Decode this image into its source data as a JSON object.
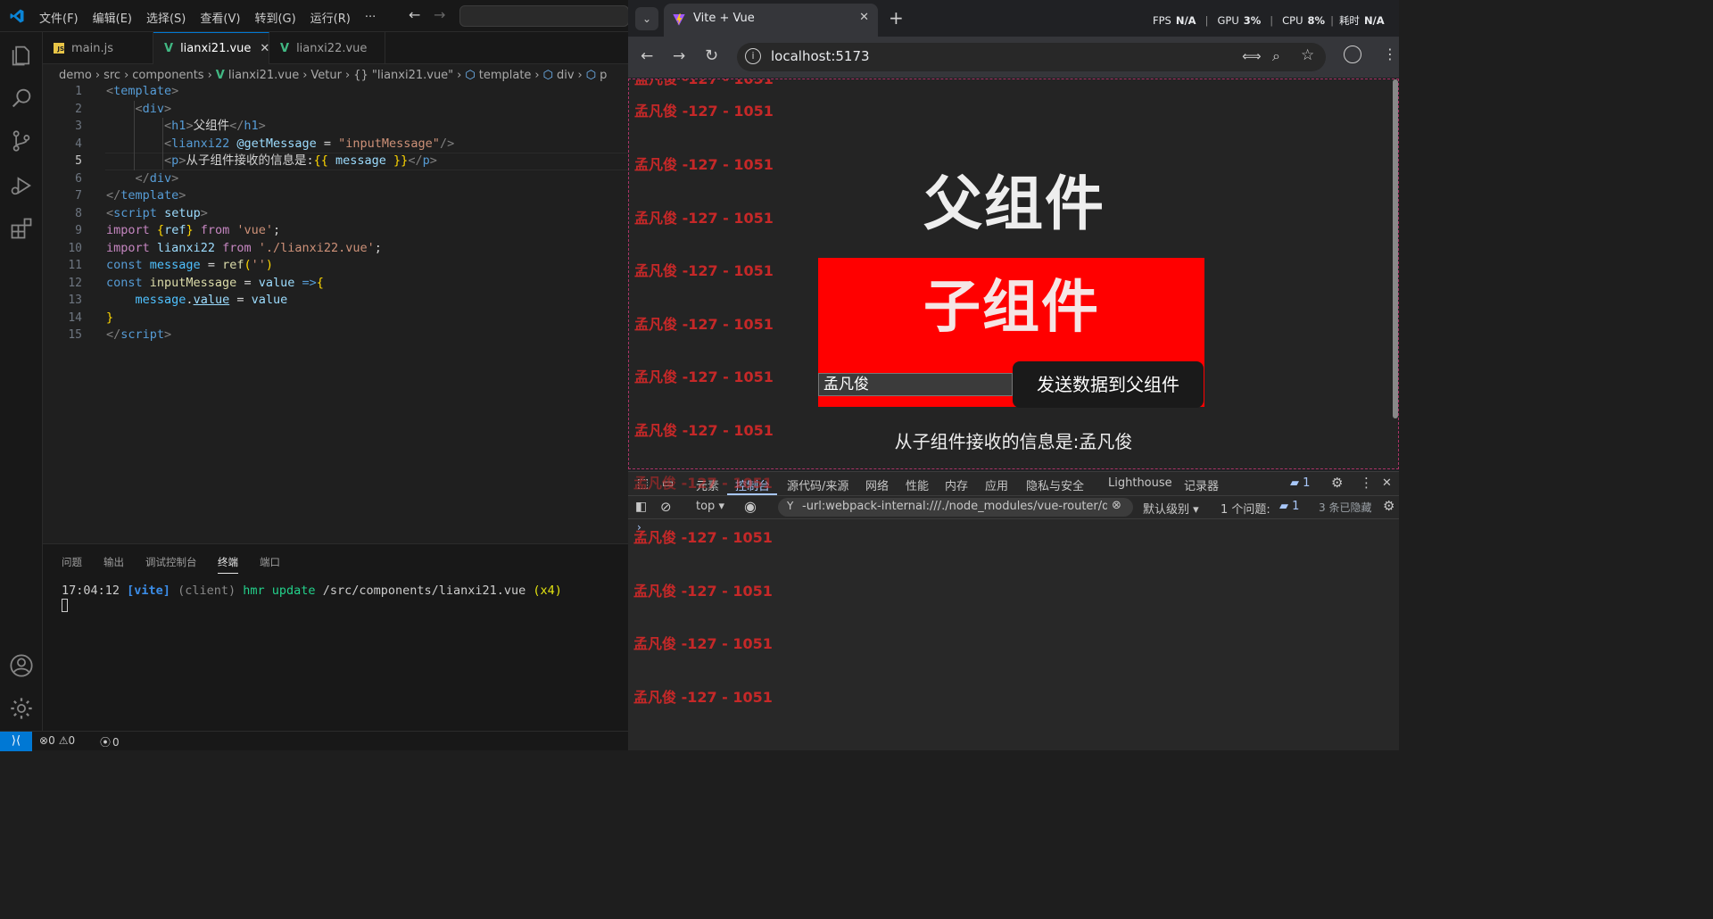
{
  "vscode": {
    "menu": [
      "文件(F)",
      "编辑(E)",
      "选择(S)",
      "查看(V)",
      "转到(G)",
      "运行(R)",
      "···"
    ],
    "tabs": [
      {
        "label": "main.js",
        "icon": "js-file-icon"
      },
      {
        "label": "lianxi21.vue",
        "icon": "vue-file-icon",
        "active": true
      },
      {
        "label": "lianxi22.vue",
        "icon": "vue-file-icon"
      }
    ],
    "breadcrumb": [
      "demo",
      "src",
      "components",
      "lianxi21.vue",
      "Vetur",
      "{} \"lianxi21.vue\"",
      "template",
      "div",
      "p"
    ],
    "line_numbers": [
      "1",
      "2",
      "3",
      "4",
      "5",
      "6",
      "7",
      "8",
      "9",
      "10",
      "11",
      "12",
      "13",
      "14",
      "15"
    ],
    "active_line": "5",
    "code": {
      "l1_template": "template",
      "l2_div": "div",
      "l3_h1": "h1",
      "l3_text": "父组件",
      "l4_tag": "lianxi22",
      "l4_attr": "@getMessage",
      "l4_value": "\"inputMessage\"",
      "l5_p": "p",
      "l5_text": "从子组件接收的信息是:",
      "l5_var": "message",
      "l6_div": "div",
      "l7_template": "template",
      "l8_script": "script",
      "l8_setup": "setup",
      "l9_import": "import",
      "l9_ref": "ref",
      "l9_from": "from",
      "l9_mod": "'vue'",
      "l10_import": "import",
      "l10_name": "lianxi22",
      "l10_from": "from",
      "l10_mod": "'./lianxi22.vue'",
      "l11_const": "const",
      "l11_name": "message",
      "l11_fn": "ref",
      "l11_arg": "''",
      "l12_const": "const",
      "l12_name": "inputMessage",
      "l12_param": "value",
      "l13_obj": "message",
      "l13_prop": "value",
      "l13_rhs": "value",
      "l15_script": "script"
    },
    "panel_tabs": [
      "问题",
      "输出",
      "调试控制台",
      "终端",
      "端口"
    ],
    "panel_active": "终端",
    "terminal": {
      "time": "17:04:12",
      "tag": "[vite]",
      "client": "(client)",
      "event": "hmr update",
      "path": "/src/components/lianxi21.vue",
      "count": "(x4)"
    },
    "status": {
      "errors": "0",
      "warnings": "0",
      "ports": "0"
    }
  },
  "browser": {
    "tab_title": "Vite + Vue",
    "url": "localhost:5173",
    "perf": {
      "fps_label": "FPS",
      "fps": "N/A",
      "gpu_label": "GPU",
      "gpu": "3%",
      "cpu_label": "CPU",
      "cpu": "8%",
      "time_label": "耗时",
      "time": "N/A"
    },
    "page": {
      "h1": "父组件",
      "child_title": "子组件",
      "input_value": "孟凡俊",
      "button_label": "发送数据到父组件",
      "message_prefix": "从子组件接收的信息是:",
      "message_value": "孟凡俊"
    },
    "watermark": "孟凡俊 -127 - 1051",
    "devtools": {
      "tabs": [
        "元素",
        "控制台",
        "源代码/来源",
        "网络",
        "性能",
        "内存",
        "应用",
        "隐私与安全",
        "Lighthouse",
        "记录器"
      ],
      "active_tab": "控制台",
      "issue_badge": "1",
      "context": "top",
      "filter": "-url:webpack-internal:///./node_modules/vue-router/dist/v",
      "level": "默认级别",
      "issues_label": "1 个问题:",
      "issues_count": "1",
      "hidden": "3 条已隐藏"
    }
  },
  "colors": {
    "accent": "#0078d4",
    "child_bg": "#ff0000",
    "watermark": "#c62828"
  }
}
